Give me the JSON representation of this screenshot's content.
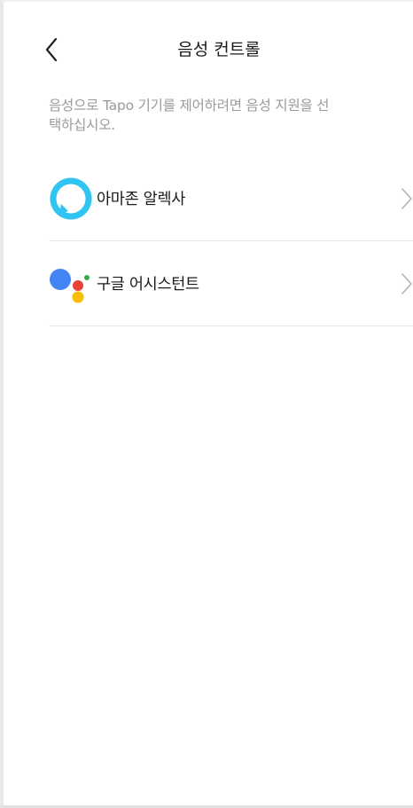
{
  "header": {
    "title": "음성 컨트롤"
  },
  "description": "음성으로 Tapo 기기를 제어하려면 음성 지원을 선택하십시오.",
  "services": [
    {
      "label": "아마존 알렉사",
      "icon": "alexa-icon"
    },
    {
      "label": "구글 어시스턴트",
      "icon": "google-assistant-icon"
    }
  ],
  "colors": {
    "alexa_blue": "#31C4F3",
    "google_blue": "#4285F4",
    "google_red": "#EA4335",
    "google_yellow": "#FBBC05",
    "google_green": "#34A853"
  }
}
